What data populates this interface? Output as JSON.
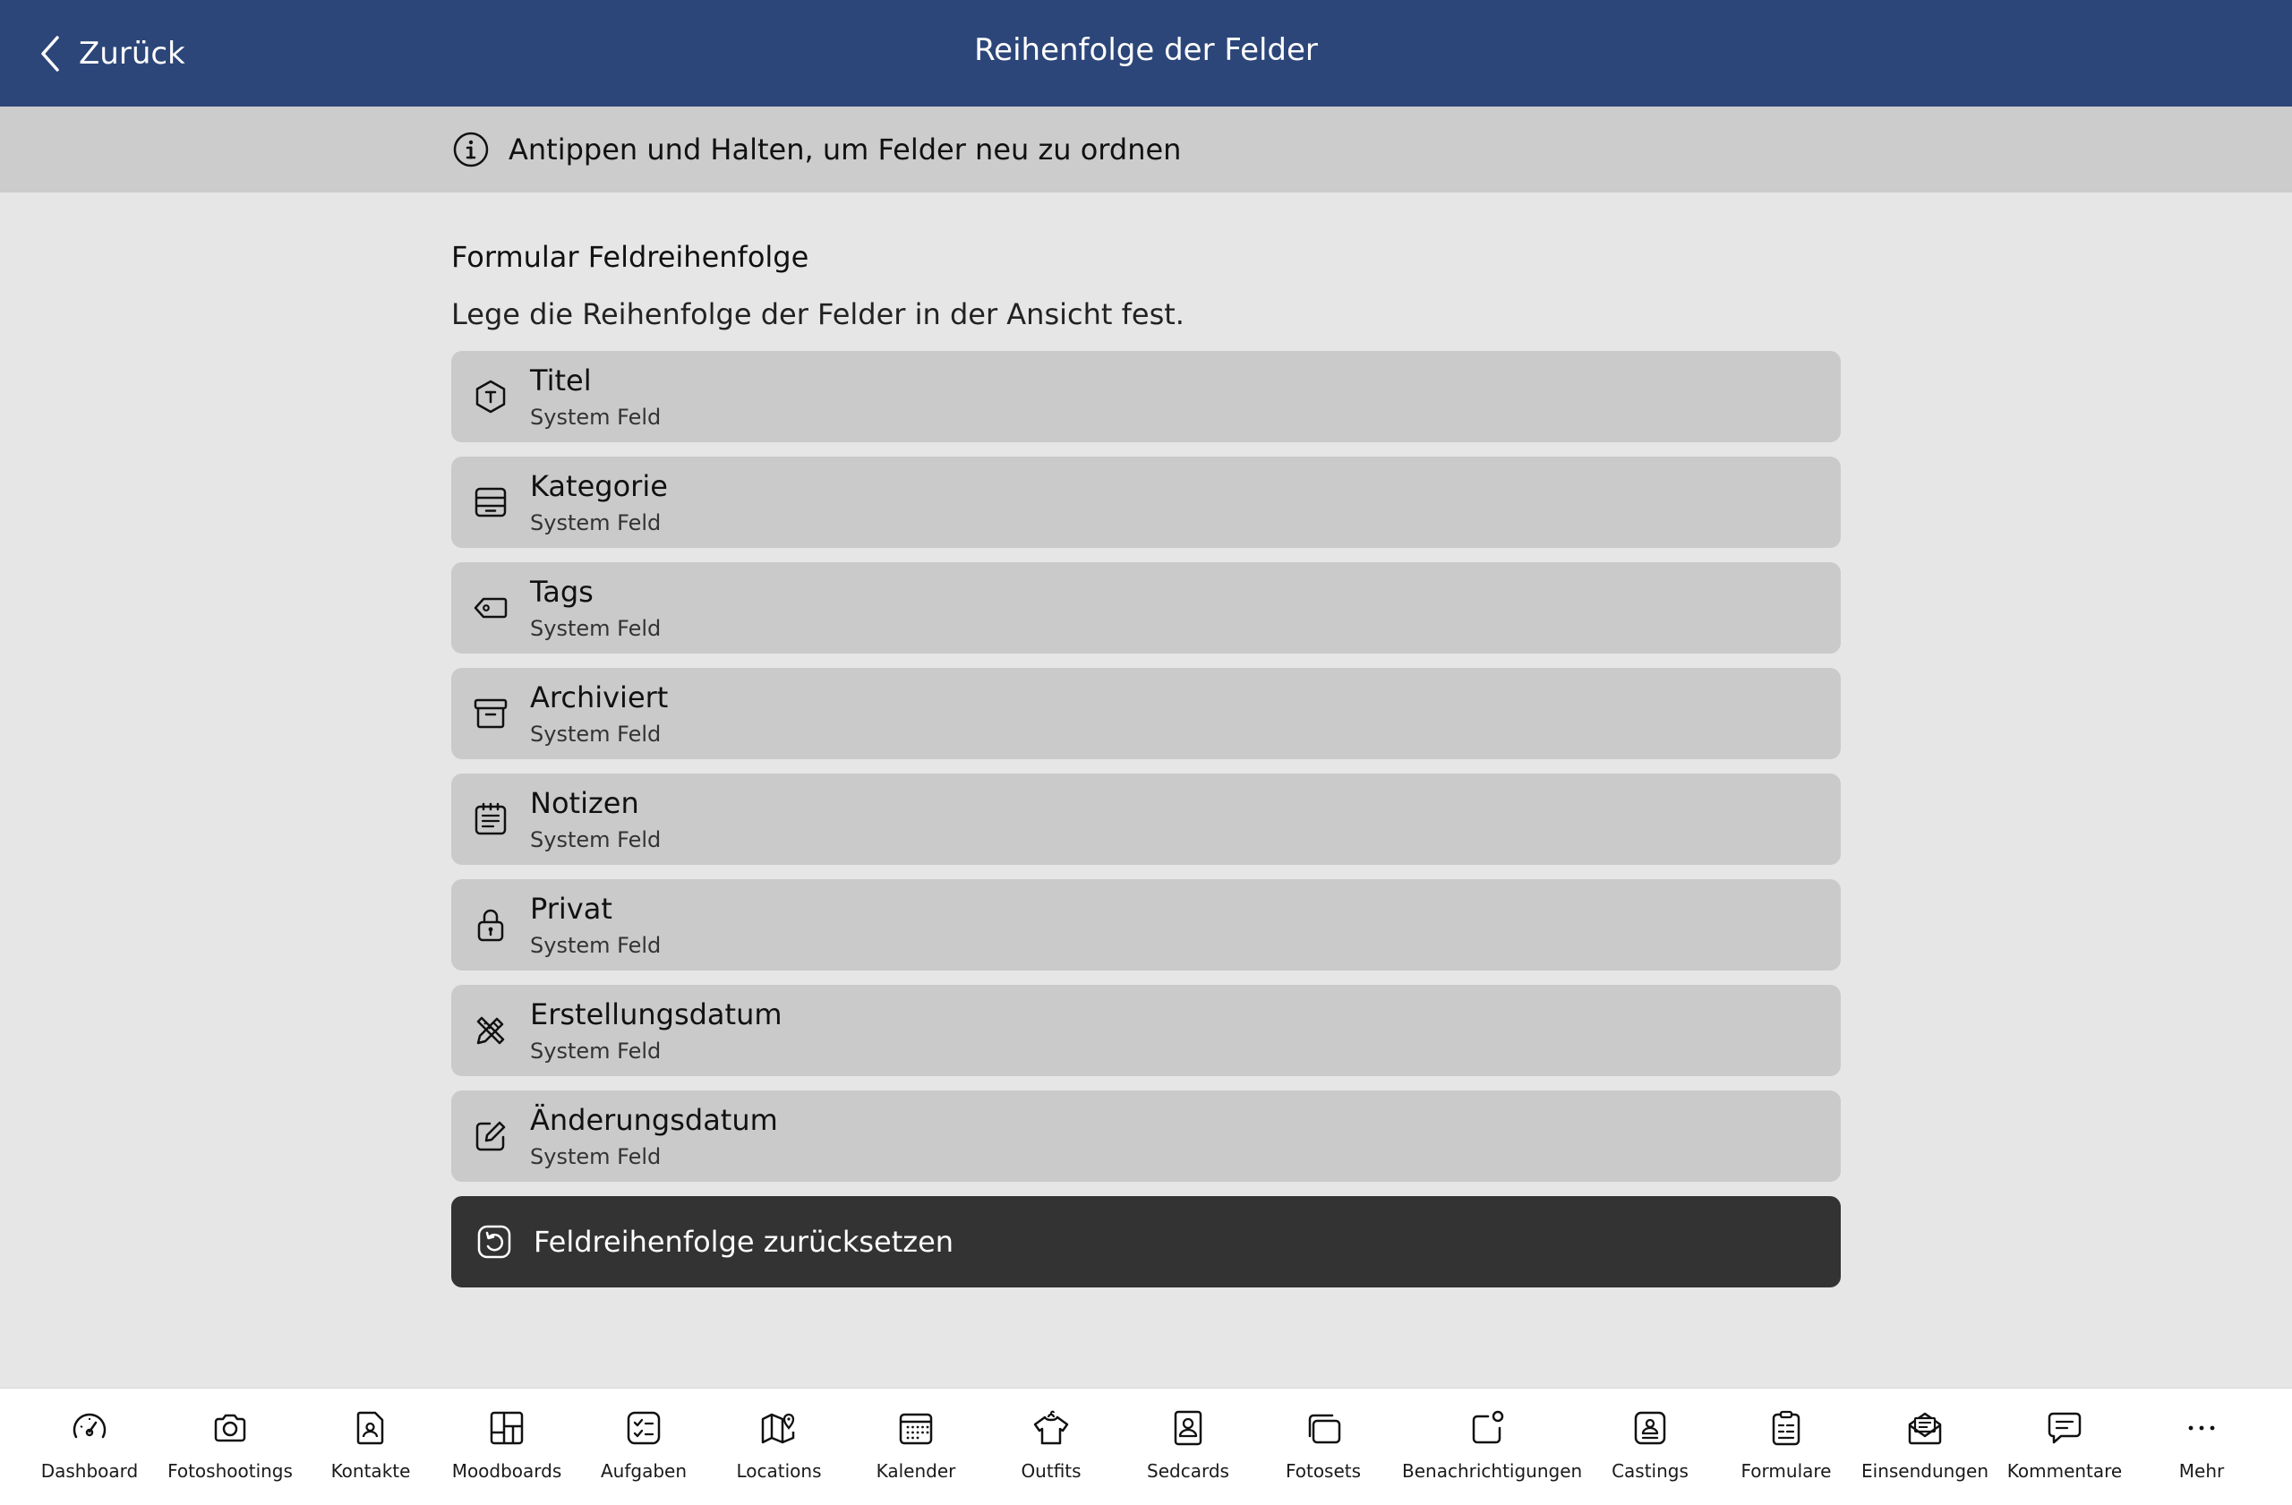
{
  "header": {
    "back_label": "Zurück",
    "title": "Reihenfolge der Felder"
  },
  "hint": {
    "text": "Antippen und Halten, um Felder neu zu ordnen",
    "icon": "info-icon"
  },
  "section": {
    "title": "Formular Feldreihenfolge",
    "description": "Lege die Reihenfolge der Felder in der Ansicht fest."
  },
  "fields": [
    {
      "name": "Titel",
      "sub": "System Feld",
      "icon": "title-hexagon-icon"
    },
    {
      "name": "Kategorie",
      "sub": "System Feld",
      "icon": "category-tray-icon"
    },
    {
      "name": "Tags",
      "sub": "System Feld",
      "icon": "tag-icon"
    },
    {
      "name": "Archiviert",
      "sub": "System Feld",
      "icon": "archive-box-icon"
    },
    {
      "name": "Notizen",
      "sub": "System Feld",
      "icon": "notes-icon"
    },
    {
      "name": "Privat",
      "sub": "System Feld",
      "icon": "lock-icon"
    },
    {
      "name": "Erstellungsdatum",
      "sub": "System Feld",
      "icon": "pencil-ruler-icon"
    },
    {
      "name": "Änderungsdatum",
      "sub": "System Feld",
      "icon": "edit-icon"
    }
  ],
  "reset": {
    "label": "Feldreihenfolge zurücksetzen",
    "icon": "reset-icon"
  },
  "tabs": [
    {
      "label": "Dashboard",
      "icon": "dashboard-gauge-icon"
    },
    {
      "label": "Fotoshootings",
      "icon": "camera-icon"
    },
    {
      "label": "Kontakte",
      "icon": "contact-file-icon"
    },
    {
      "label": "Moodboards",
      "icon": "moodboard-grid-icon"
    },
    {
      "label": "Aufgaben",
      "icon": "tasks-checklist-icon"
    },
    {
      "label": "Locations",
      "icon": "map-pin-icon"
    },
    {
      "label": "Kalender",
      "icon": "calendar-icon"
    },
    {
      "label": "Outfits",
      "icon": "outfit-shirt-icon"
    },
    {
      "label": "Sedcards",
      "icon": "sedcard-icon"
    },
    {
      "label": "Fotosets",
      "icon": "photosets-icon"
    },
    {
      "label": "Benachrichtigungen",
      "icon": "notification-icon"
    },
    {
      "label": "Castings",
      "icon": "casting-card-icon"
    },
    {
      "label": "Formulare",
      "icon": "form-clipboard-icon"
    },
    {
      "label": "Einsendungen",
      "icon": "submission-mail-icon"
    },
    {
      "label": "Kommentare",
      "icon": "comment-icon"
    },
    {
      "label": "Mehr",
      "icon": "more-dots-icon"
    }
  ],
  "colors": {
    "header_bg": "#2c4679",
    "hint_bg": "#cccccc",
    "page_bg": "#e6e6e6",
    "field_bg": "#cacaca",
    "reset_bg": "#333333"
  }
}
